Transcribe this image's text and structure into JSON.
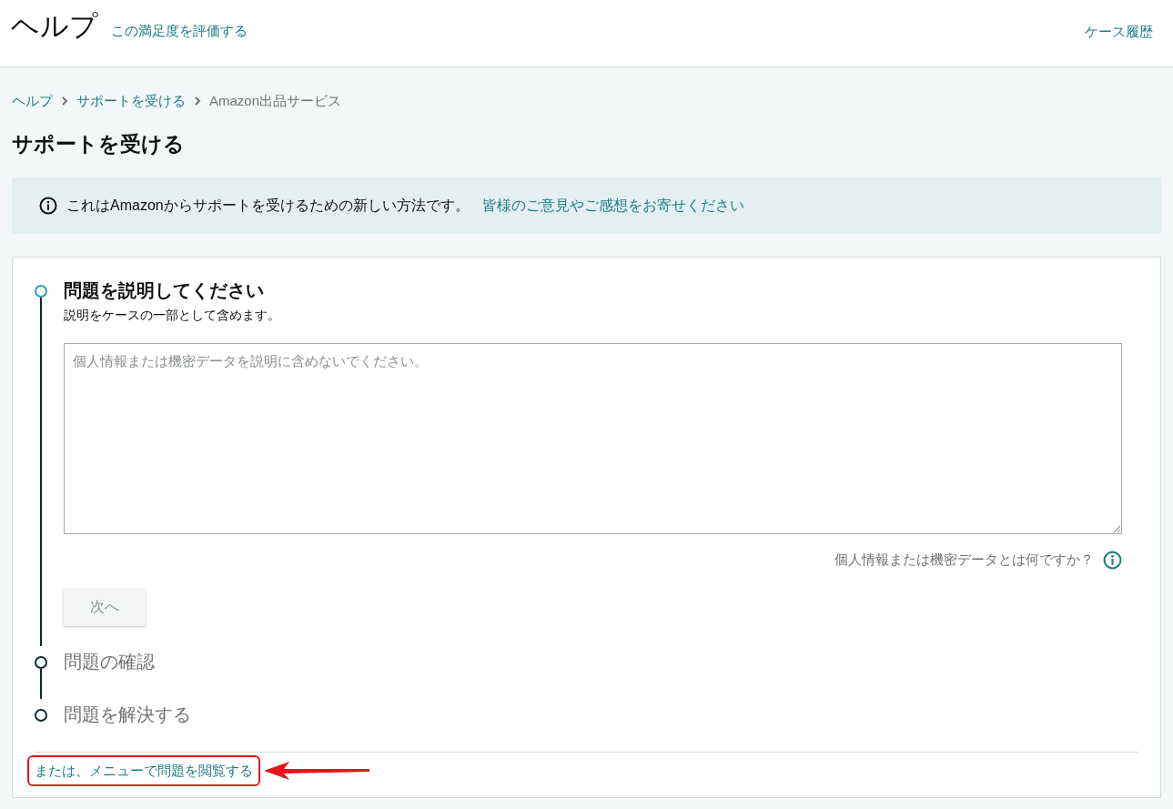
{
  "header": {
    "title": "ヘルプ",
    "rate_link": "この満足度を評価する",
    "case_history_link": "ケース履歴"
  },
  "breadcrumb": [
    {
      "label": "ヘルプ",
      "kind": "link"
    },
    {
      "label": "サポートを受ける",
      "kind": "link"
    },
    {
      "label": "Amazon出品サービス",
      "kind": "current"
    }
  ],
  "page_title": "サポートを受ける",
  "notice": {
    "text": "これはAmazonからサポートを受けるための新しい方法です。",
    "link": "皆様のご意見やご感想をお寄せください"
  },
  "steps": [
    {
      "title": "問題を説明してください",
      "selected": true,
      "subtitle": "説明をケースの一部として含めます。",
      "placeholder": "個人情報または機密データを説明に含めないでください。",
      "help_text": "個人情報または機密データとは何ですか？",
      "button": "次へ"
    },
    {
      "title": "問題の確認",
      "selected": false
    },
    {
      "title": "問題を解決する",
      "selected": false
    }
  ],
  "browse_link": "または、メニューで問題を閲覧する"
}
